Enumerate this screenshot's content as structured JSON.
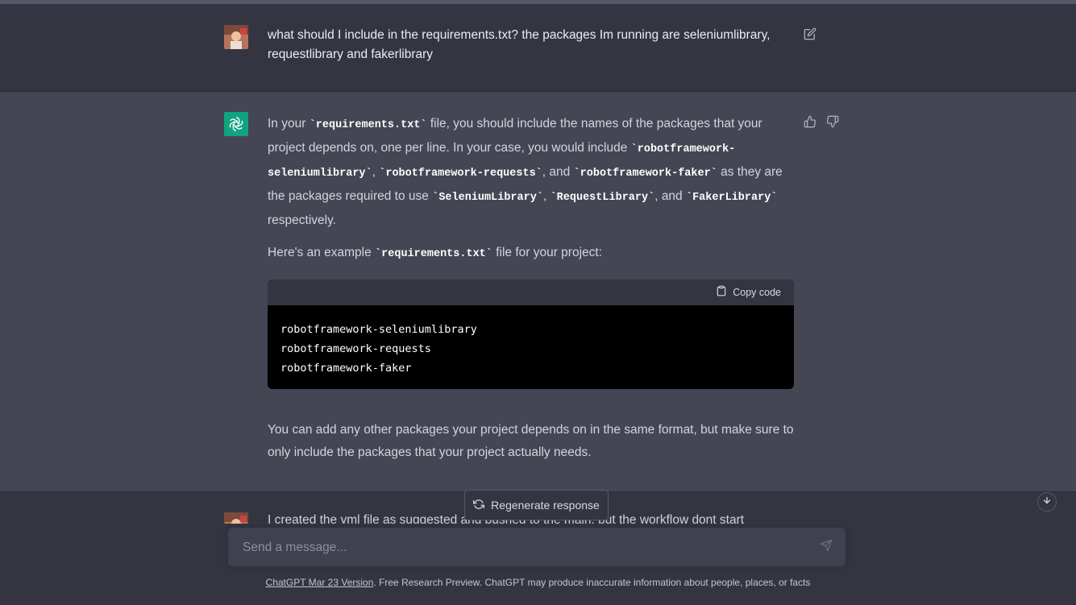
{
  "conversation": {
    "user_message": "what should I include in the requirements.txt? the packages Im running are seleniumlibrary, requestlibrary and fakerlibrary",
    "assistant": {
      "para1": {
        "t1": "In your ",
        "c1": "`requirements.txt`",
        "t2": " file, you should include the names of the packages that your project depends on, one per line. In your case, you would include ",
        "c2": "`robotframework-seleniumlibrary`",
        "t3": ", ",
        "c3": "`robotframework-requests`",
        "t4": ", and ",
        "c4": "`robotframework-faker`",
        "t5": " as they are the packages required to use ",
        "c5": "`SeleniumLibrary`",
        "t6": ", ",
        "c6": "`RequestLibrary`",
        "t7": ", and ",
        "c7": "`FakerLibrary`",
        "t8": " respectively."
      },
      "para2": {
        "t1": "Here's an example ",
        "c1": "`requirements.txt`",
        "t2": " file for your project:"
      },
      "code_block": {
        "copy_label": "Copy code",
        "lines": [
          "robotframework-seleniumlibrary",
          "robotframework-requests",
          "robotframework-faker"
        ]
      },
      "para3": "You can add any other packages your project depends on in the same format, but make sure to only include the packages that your project actually needs."
    },
    "next_user_message_partial": "I created the yml file as suggested and pushed to the main, but the workflow dont start"
  },
  "controls": {
    "regenerate_label": "Regenerate response",
    "input_placeholder": "Send a message..."
  },
  "footer": {
    "link_text": "ChatGPT Mar 23 Version",
    "text": ". Free Research Preview. ChatGPT may produce inaccurate information about people, places, or facts"
  },
  "colors": {
    "background": "#343541",
    "assistant_background": "#444654",
    "gpt_avatar": "#10a37f",
    "input_background": "#40414f"
  },
  "icons": [
    "edit-icon",
    "thumbs-up-icon",
    "thumbs-down-icon",
    "clipboard-icon",
    "refresh-icon",
    "arrow-down-icon",
    "send-icon",
    "openai-logo-icon"
  ]
}
